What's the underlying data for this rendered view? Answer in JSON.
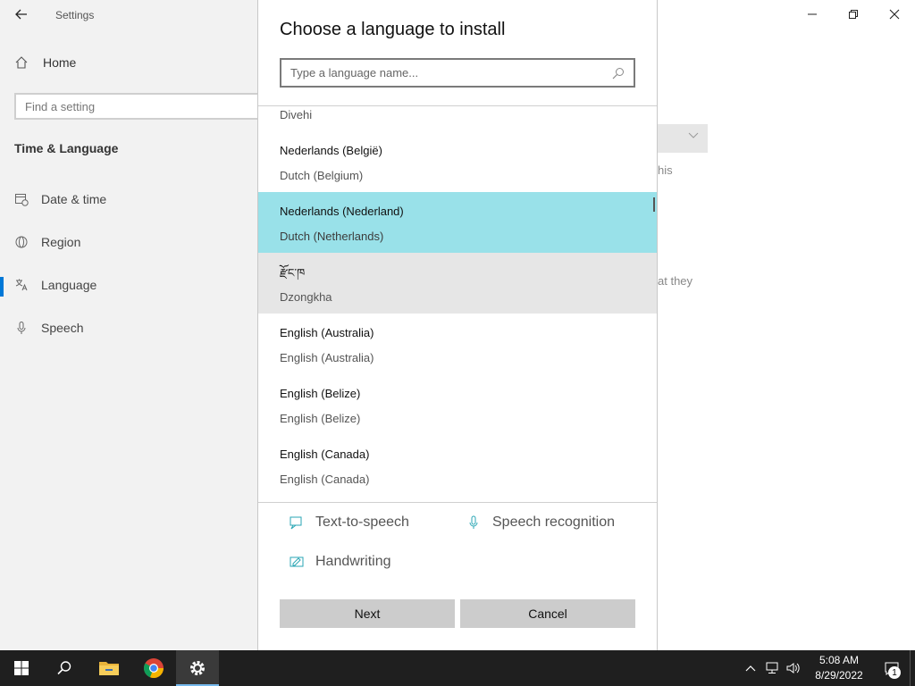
{
  "settings": {
    "window_title": "Settings",
    "home_label": "Home",
    "find_placeholder": "Find a setting",
    "section_title": "Time & Language",
    "nav": [
      {
        "label": "Date & time",
        "icon": "calendar-clock-icon"
      },
      {
        "label": "Region",
        "icon": "globe-icon"
      },
      {
        "label": "Language",
        "icon": "language-icon"
      },
      {
        "label": "Speech",
        "icon": "microphone-icon"
      }
    ],
    "active_nav": "Language",
    "background_text_1": "his",
    "background_text_2": "at they",
    "accent_color": "#0078d7"
  },
  "dialog": {
    "title": "Choose a language to install",
    "search_placeholder": "Type a language name...",
    "partial_item": "Divehi",
    "languages": [
      {
        "native": "Nederlands (België)",
        "english": "Dutch (Belgium)",
        "state": "normal"
      },
      {
        "native": "Nederlands (Nederland)",
        "english": "Dutch (Netherlands)",
        "state": "selected"
      },
      {
        "native": "རྫོང་ཁ",
        "english": "Dzongkha",
        "state": "hover"
      },
      {
        "native": "English (Australia)",
        "english": "English (Australia)",
        "state": "normal"
      },
      {
        "native": "English (Belize)",
        "english": "English (Belize)",
        "state": "normal"
      },
      {
        "native": "English (Canada)",
        "english": "English (Canada)",
        "state": "normal"
      }
    ],
    "selected_color": "#99e1e9",
    "features": {
      "tts": "Text-to-speech",
      "speech": "Speech recognition",
      "handwriting": "Handwriting"
    },
    "next_label": "Next",
    "cancel_label": "Cancel"
  },
  "taskbar": {
    "apps": [
      "start-icon",
      "search-icon",
      "file-explorer-icon",
      "chrome-icon",
      "settings-gear-icon"
    ],
    "time": "5:08 AM",
    "date": "8/29/2022",
    "notification_count": "1"
  }
}
